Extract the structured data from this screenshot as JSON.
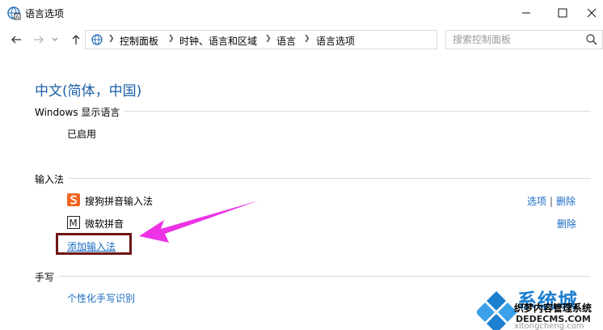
{
  "window": {
    "title": "语言选项"
  },
  "address_bar": {
    "breadcrumbs": [
      "控制面板",
      "时钟、语言和区域",
      "语言",
      "语言选项"
    ]
  },
  "search": {
    "placeholder": "搜索控制面板"
  },
  "main": {
    "page_title": "中文(简体，中国)",
    "display_language": {
      "heading": "Windows 显示语言",
      "status": "已启用"
    },
    "input_methods": {
      "heading": "输入法",
      "items": [
        {
          "name": "搜狗拼音输入法",
          "icon": "sogou-icon",
          "options_label": "选项",
          "remove_label": "删除"
        },
        {
          "name": "微软拼音",
          "icon": "microsoft-pinyin-icon",
          "remove_label": "删除"
        }
      ],
      "add_label": "添加输入法"
    },
    "handwriting": {
      "heading": "手写",
      "link_label": "个性化手写识别"
    }
  },
  "annotation": {
    "box_color": "#6e1515",
    "arrow_color": "#ee33e6"
  },
  "watermark": {
    "big_text": "系统城",
    "line1": "织梦内容管理系统",
    "line2": "DEDECMS.COM",
    "line3": "xitongcheng.com"
  }
}
